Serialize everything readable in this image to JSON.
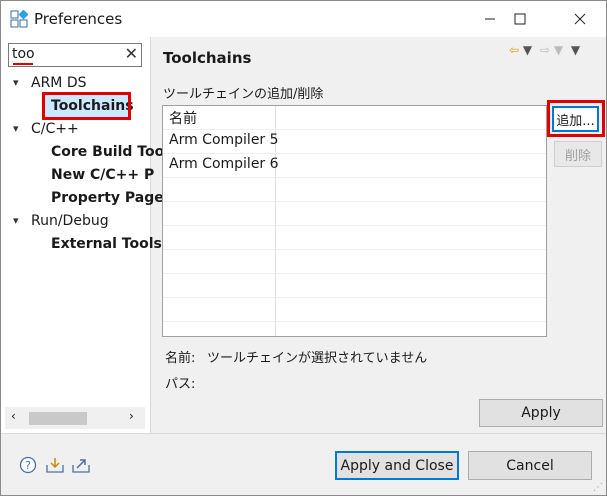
{
  "window": {
    "title": "Preferences"
  },
  "filter": {
    "value": "too"
  },
  "tree": {
    "items": [
      {
        "label": "ARM DS",
        "expanded": true
      },
      {
        "label": "Toolchains",
        "selected": true
      },
      {
        "label": "C/C++",
        "expanded": true
      },
      {
        "label": "Core Build Too"
      },
      {
        "label": "New C/C++ P"
      },
      {
        "label": "Property Page"
      },
      {
        "label": "Run/Debug",
        "expanded": true
      },
      {
        "label": "External Tools"
      }
    ]
  },
  "page": {
    "title": "Toolchains",
    "section_label": "ツールチェインの追加/削除",
    "table": {
      "header": "名前",
      "rows": [
        "Arm Compiler 5",
        "Arm Compiler 6"
      ]
    },
    "buttons": {
      "add": "追加...",
      "delete": "削除",
      "apply": "Apply"
    },
    "name_label": "名前:",
    "name_value": "ツールチェインが選択されていません",
    "path_label": "パス:"
  },
  "footer": {
    "apply_close": "Apply and Close",
    "cancel": "Cancel"
  },
  "colors": {
    "selection": "#cce8ff",
    "annotation": "#e00000",
    "focus": "#0078d7"
  }
}
